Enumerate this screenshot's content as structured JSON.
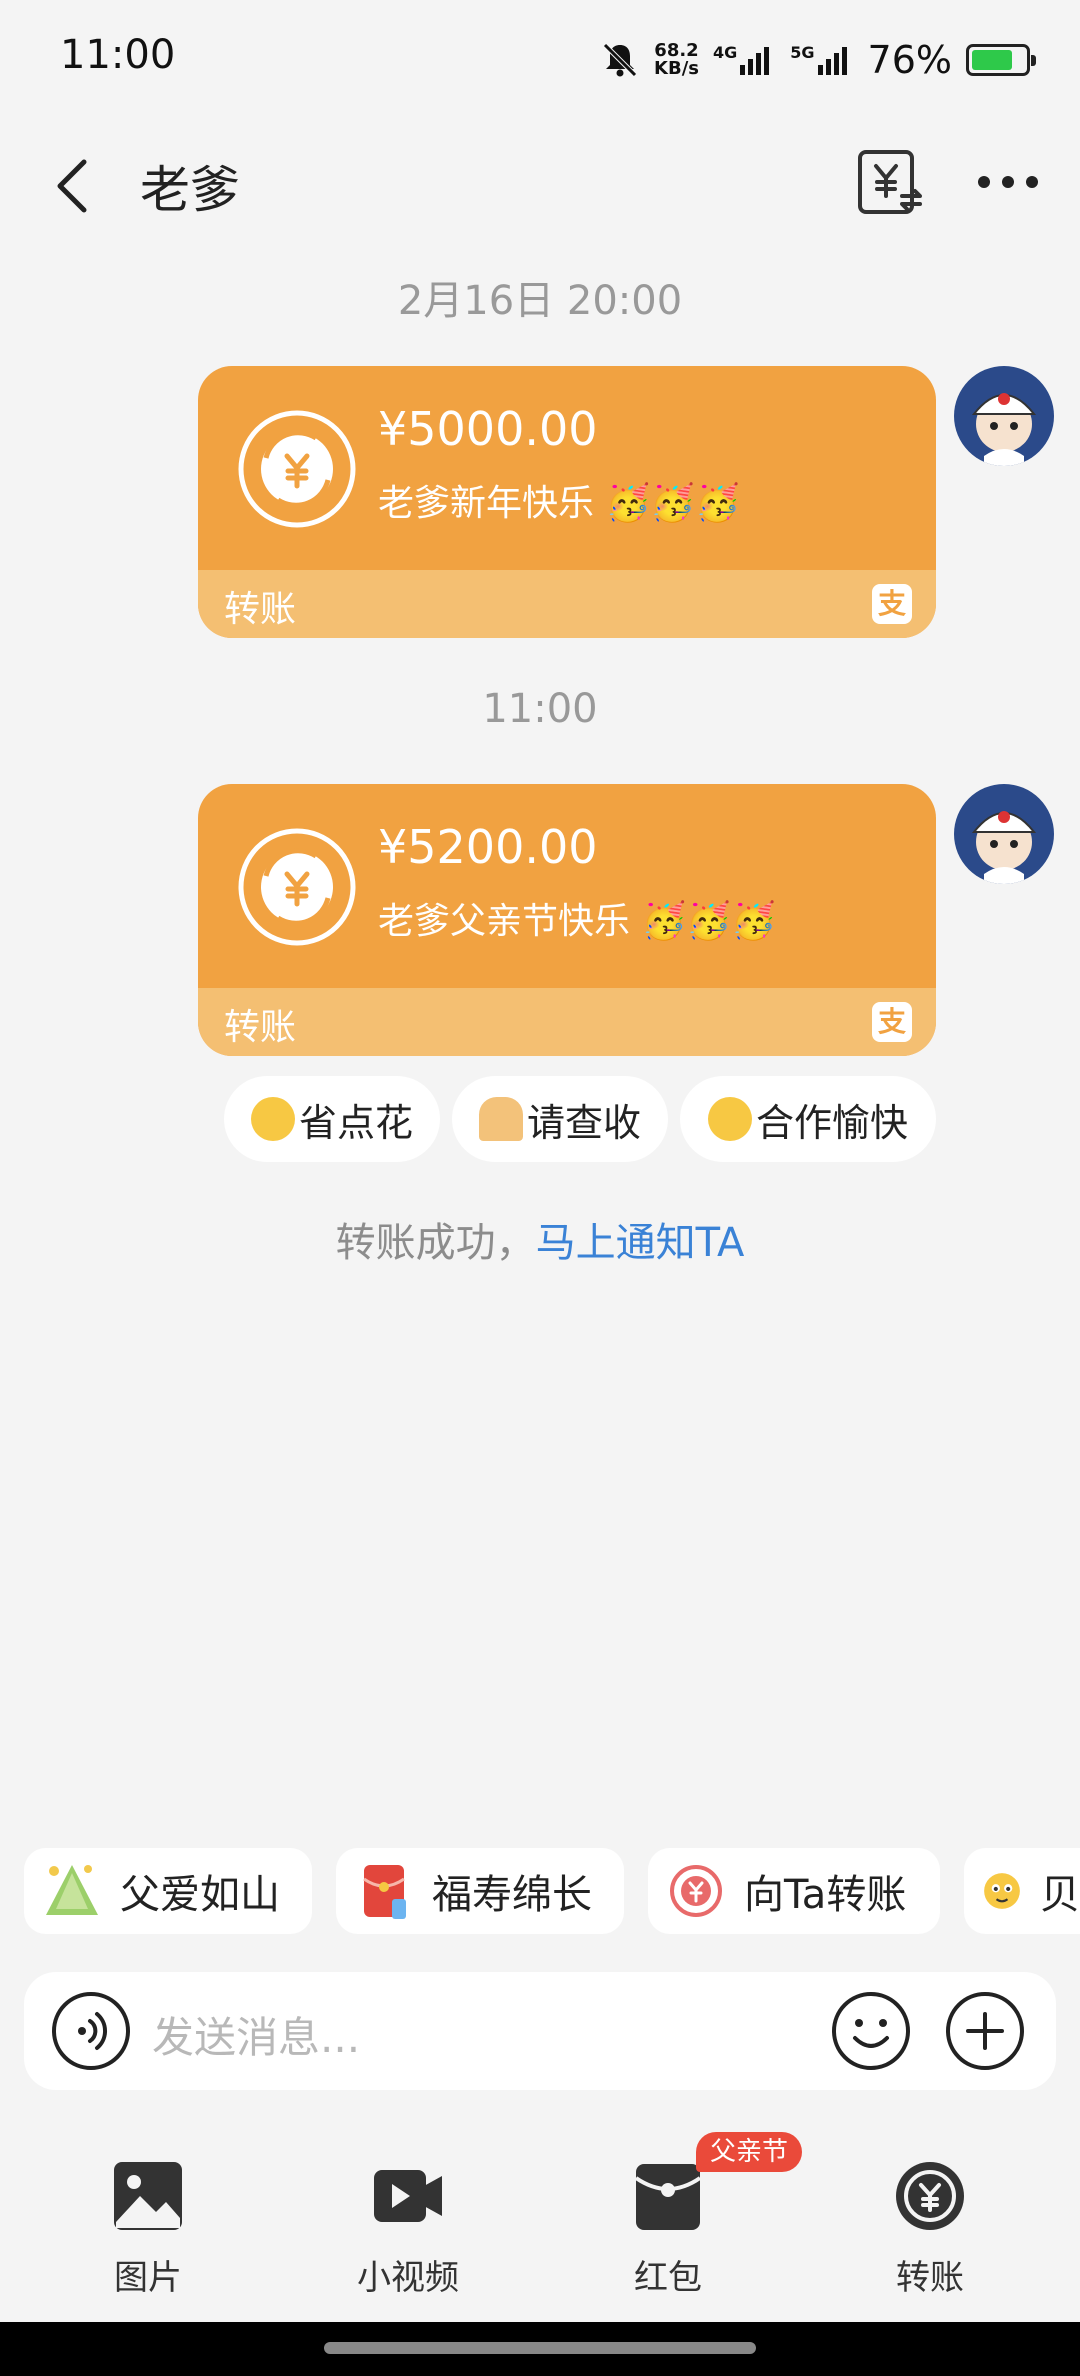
{
  "status_bar": {
    "time": "11:00",
    "speed_value": "68.2",
    "speed_unit": "KB/s",
    "net1": "4G",
    "net2": "5G",
    "battery": "76%",
    "battery_level": 0.76,
    "battery_color": "#2ec94a"
  },
  "header": {
    "title": "老爹"
  },
  "messages": [
    {
      "timestamp": "2月16日 20:00",
      "amount": "¥5000.00",
      "note": "老爹新年快乐 🥳🥳🥳",
      "label": "转账",
      "brand": "支"
    },
    {
      "timestamp": "11:00",
      "amount": "¥5200.00",
      "note": "老爹父亲节快乐 🥳🥳🥳",
      "label": "转账",
      "brand": "支"
    }
  ],
  "quick_replies": [
    {
      "icon": "smirk-emoji-icon",
      "label": "省点花"
    },
    {
      "icon": "pray-hands-icon",
      "label": "请查收"
    },
    {
      "icon": "smile-emoji-icon",
      "label": "合作愉快"
    }
  ],
  "notice": {
    "text": "转账成功，",
    "link": "马上通知TA"
  },
  "suggestions": [
    {
      "icon": "zongzi-icon",
      "label": "父爱如山"
    },
    {
      "icon": "red-envelope-icon",
      "label": "福寿绵长"
    },
    {
      "icon": "transfer-circle-icon",
      "label": "向Ta转账"
    },
    {
      "icon": "emoji-icon",
      "label": "贝"
    }
  ],
  "input": {
    "placeholder": "发送消息..."
  },
  "tools": [
    {
      "icon": "image-icon",
      "label": "图片"
    },
    {
      "icon": "video-icon",
      "label": "小视频"
    },
    {
      "icon": "red-packet-icon",
      "label": "红包",
      "badge": "父亲节"
    },
    {
      "icon": "transfer-icon",
      "label": "转账"
    }
  ],
  "colors": {
    "card": "#f1a241",
    "card_footer": "#f4bf72",
    "link": "#3a82d6",
    "badge": "#ea4a3a"
  }
}
